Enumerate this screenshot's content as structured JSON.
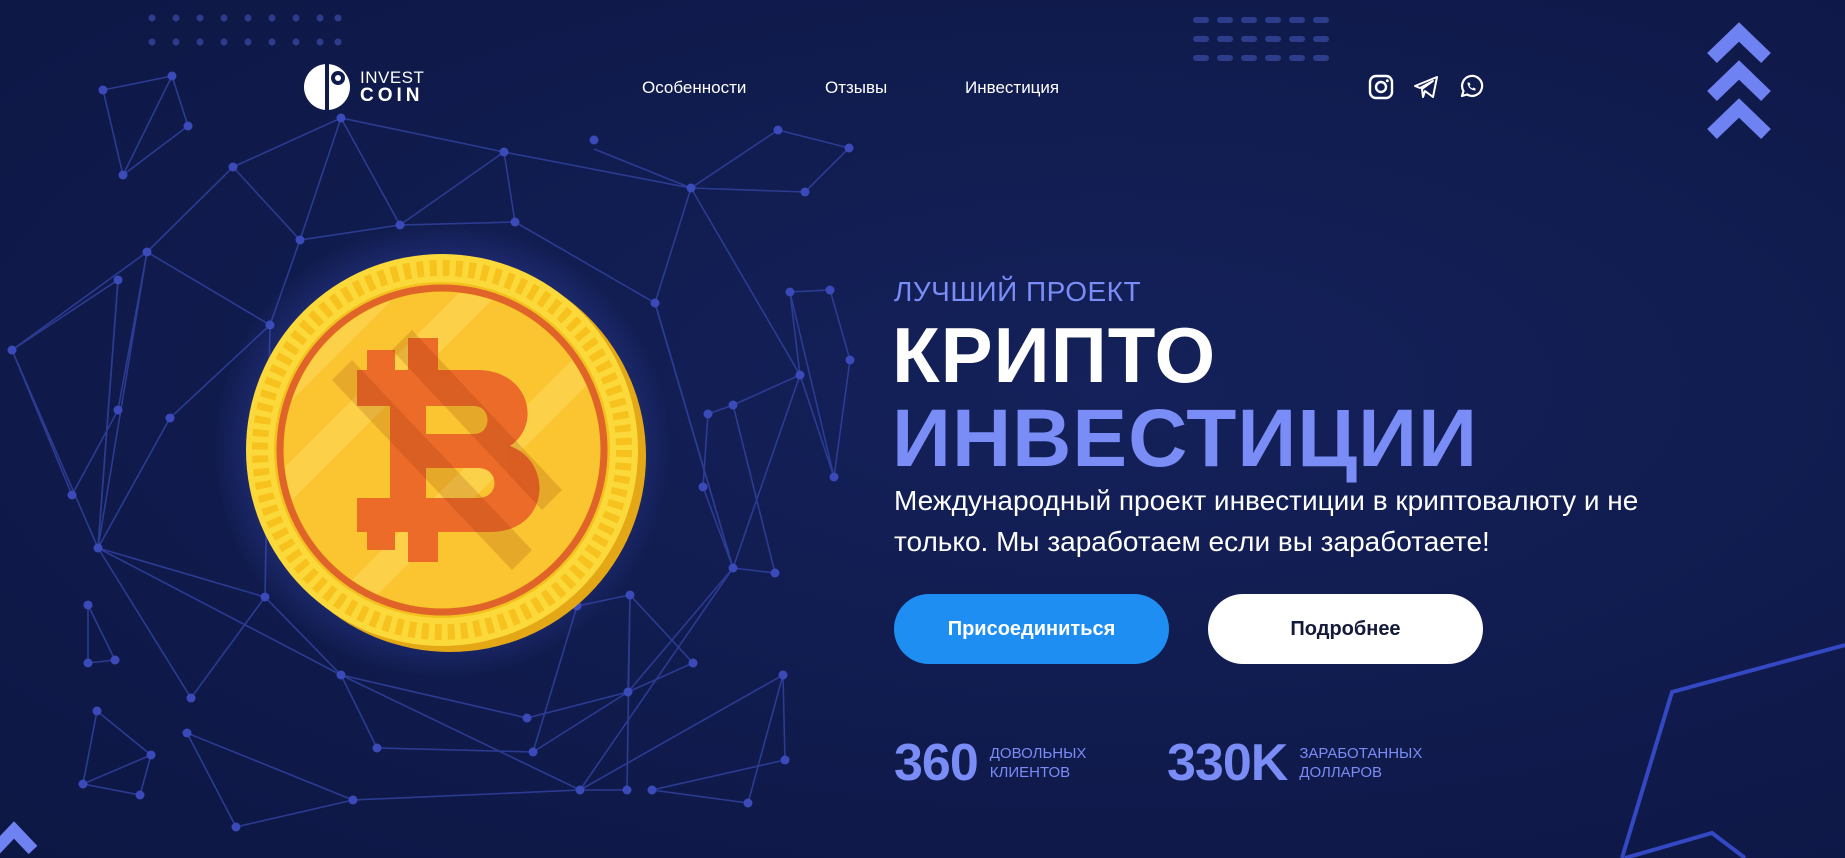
{
  "header": {
    "logo": {
      "line1": "INVEST",
      "line2": "COIN"
    },
    "nav": [
      {
        "label": "Особенности"
      },
      {
        "label": "Отзывы"
      },
      {
        "label": "Инвестиция"
      }
    ],
    "social": [
      "instagram-icon",
      "telegram-icon",
      "whatsapp-icon"
    ]
  },
  "hero": {
    "eyebrow": "ЛУЧШИЙ ПРОЕКТ",
    "title_line1": "КРИПТО",
    "title_line2": "ИНВЕСТИЦИИ",
    "description": "Международный проект инвестиции в криптовалюту и не только. Мы заработаем если вы заработаете!",
    "primary_button": "Присоединиться",
    "secondary_button": "Подробнее"
  },
  "stats": [
    {
      "value": "360",
      "label": "ДОВОЛЬНЫХ КЛИЕНТОВ"
    },
    {
      "value": "330K",
      "label": "ЗАРАБОТАННЫХ ДОЛЛАРОВ"
    }
  ],
  "colors": {
    "background": "#101b4d",
    "accent": "#7a8cf5",
    "primary_button": "#1e8ef2",
    "coin_gold": "#fbc531",
    "coin_orange": "#ec6b29"
  }
}
